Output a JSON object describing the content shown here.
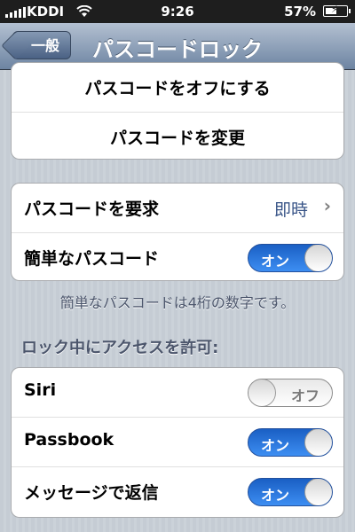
{
  "status_bar": {
    "carrier": "KDDI",
    "time": "9:26",
    "battery_percent": "57%",
    "battery_level": 0.57,
    "icons": [
      "signal-icon",
      "wifi-icon",
      "battery-charging-icon"
    ]
  },
  "nav": {
    "back_label": "一般",
    "title": "パスコードロック"
  },
  "group1": {
    "turn_off_label": "パスコードをオフにする",
    "change_label": "パスコードを変更"
  },
  "group2": {
    "require_label": "パスコードを要求",
    "require_value": "即時",
    "simple_label": "簡単なパスコード",
    "simple_switch": "オン",
    "note": "簡単なパスコードは4桁の数字です。"
  },
  "group3": {
    "header": "ロック中にアクセスを許可:",
    "items": [
      {
        "label": "Siri",
        "state": "オフ",
        "on": false
      },
      {
        "label": "Passbook",
        "state": "オン",
        "on": true
      },
      {
        "label": "メッセージで返信",
        "state": "オン",
        "on": true
      }
    ]
  },
  "colors": {
    "switch_on": "#1a5fc4",
    "nav_bar": "#6d84a2",
    "detail_value": "#385487"
  }
}
